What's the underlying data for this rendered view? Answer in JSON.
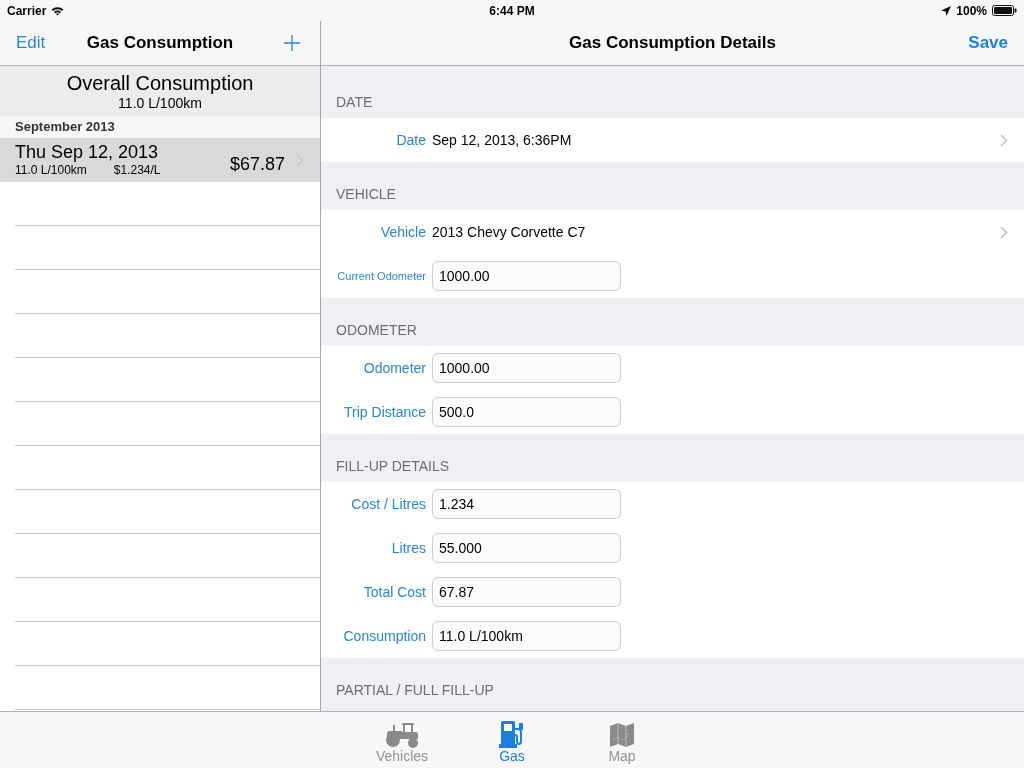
{
  "status_bar": {
    "carrier": "Carrier",
    "time": "6:44 PM",
    "battery": "100%"
  },
  "master": {
    "nav_bar": {
      "edit": "Edit",
      "title": "Gas Consumption"
    },
    "summary": {
      "title": "Overall Consumption",
      "value": "11.0 L/100km"
    },
    "sections": [
      {
        "title": "September 2013",
        "rows": [
          {
            "date": "Thu Sep 12, 2013",
            "consumption": "11.0 L/100km",
            "price": "$1.234/L",
            "total": "$67.87",
            "selected": true
          }
        ]
      }
    ]
  },
  "detail": {
    "nav_bar": {
      "title": "Gas Consumption Details",
      "save": "Save"
    },
    "sections": [
      {
        "header": "DATE",
        "rows": [
          {
            "kind": "disclosure",
            "label": "Date",
            "value": "Sep 12, 2013, 6:36PM"
          }
        ]
      },
      {
        "header": "VEHICLE",
        "rows": [
          {
            "kind": "disclosure",
            "label": "Vehicle",
            "value": "2013 Chevy Corvette C7"
          },
          {
            "kind": "field",
            "label": "Current Odometer",
            "value": "1000.00"
          }
        ]
      },
      {
        "header": "ODOMETER",
        "rows": [
          {
            "kind": "field",
            "label": "Odometer",
            "value": "1000.00"
          },
          {
            "kind": "field",
            "label": "Trip Distance",
            "value": "500.0"
          }
        ]
      },
      {
        "header": "FILL-UP DETAILS",
        "rows": [
          {
            "kind": "field",
            "label": "Cost / Litres",
            "value": "1.234"
          },
          {
            "kind": "field",
            "label": "Litres",
            "value": "55.000"
          },
          {
            "kind": "field",
            "label": "Total Cost",
            "value": "67.87"
          },
          {
            "kind": "field",
            "label": "Consumption",
            "value": "11.0 L/100km"
          }
        ]
      },
      {
        "header": "PARTIAL / FULL FILL-UP"
      }
    ]
  },
  "tab_bar": {
    "tabs": [
      {
        "label": "Vehicles",
        "selected": false
      },
      {
        "label": "Gas",
        "selected": true
      },
      {
        "label": "Map",
        "selected": false
      }
    ]
  }
}
